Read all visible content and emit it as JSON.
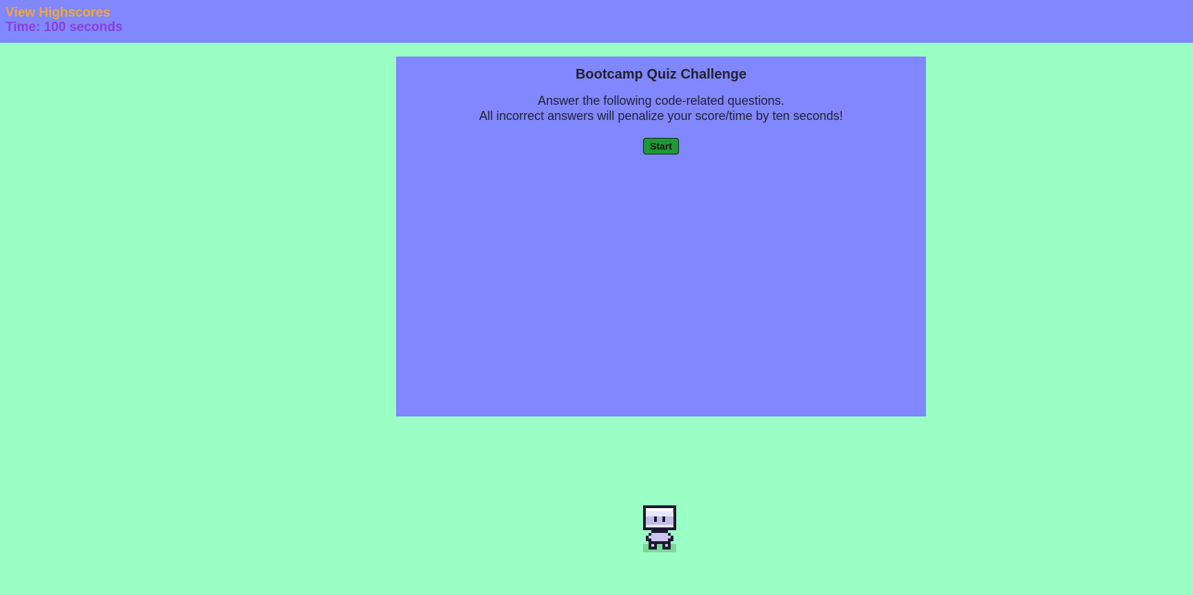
{
  "header": {
    "highscores_label": "View Highscores",
    "timer_text": "Time: 100 seconds"
  },
  "quiz": {
    "title": "Bootcamp Quiz Challenge",
    "desc_line1": "Answer the following code-related questions.",
    "desc_line2": "All incorrect answers will penalize your score/time by ten seconds!",
    "start_label": "Start"
  },
  "colors": {
    "background": "#99ffc4",
    "panel": "#8087ff",
    "highscores": "#f2a640",
    "timer": "#8c3fd9",
    "start_button": "#1f9933"
  },
  "icons": {
    "character": "robot-character-icon"
  }
}
